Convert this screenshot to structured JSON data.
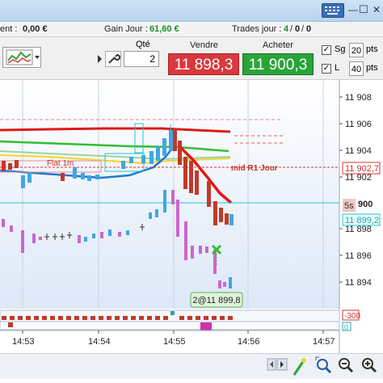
{
  "window": {
    "minimize": "—",
    "maximize": "☐",
    "close": "✕"
  },
  "info": {
    "equity_label": "ent :",
    "equity_value": "0,00 €",
    "gain_label": "Gain Jour :",
    "gain_value": "61,60 €",
    "trades_label": "Trades jour :",
    "trades_a": "4",
    "trades_b": "0",
    "trades_c": "0"
  },
  "toolbar": {
    "qty_label": "Qté",
    "qty_value": "2",
    "sell_label": "Vendre",
    "buy_label": "Acheter",
    "sell_price": "11 898,3",
    "buy_price": "11 900,3",
    "sg_label": "Sg",
    "sg_value": "20",
    "sg_unit": "pts",
    "l_label": "L",
    "l_value": "40",
    "l_unit": "pts"
  },
  "chart": {
    "y_ticks": [
      "11 908",
      "11 906",
      "11 904",
      "11 902",
      "11 900",
      "11 898",
      "11 896",
      "11 894"
    ],
    "x_ticks": [
      "14:53",
      "14:54",
      "14:55",
      "14:56",
      "14:57"
    ],
    "flat_label": "Flat 1m",
    "mid_label": "mid R1 Jour",
    "level_1": "11 902,7",
    "level_2": "11 899,2",
    "timeframe": "5s",
    "price_tag": "900",
    "position_label": "2@11 899,8",
    "indicator_top": "-300",
    "indicator_zero": "0",
    "colors": {
      "up": "#3ea8e0",
      "down": "#c0392b",
      "ma_red": "#e01818",
      "ma_green": "#2ec02e",
      "ma_blue": "#1e78d0",
      "ma_yellow": "#f2d23a",
      "cyan_line": "#22c6d6"
    }
  },
  "bottom": {
    "icons": [
      "scroll-left-icon",
      "scroll-right-icon",
      "magic-zoom-icon",
      "zoom-fit-icon",
      "zoom-out-icon",
      "zoom-in-icon"
    ]
  }
}
